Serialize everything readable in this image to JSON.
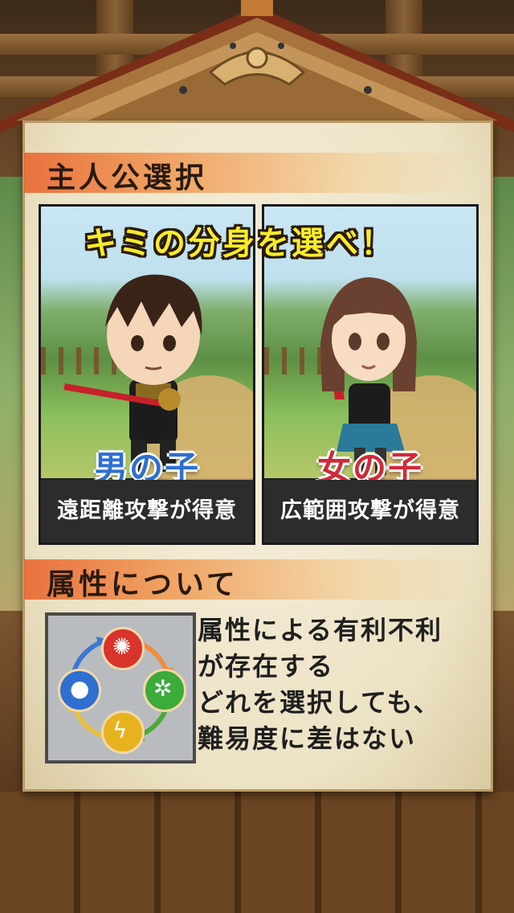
{
  "screen": {
    "section1_title": "主人公選択",
    "headline": "キミの分身を選べ！",
    "characters": [
      {
        "name": "男の子",
        "description": "遠距離攻撃が得意",
        "name_color": "#2e6fd0"
      },
      {
        "name": "女の子",
        "description": "広範囲攻撃が得意",
        "name_color": "#d02a3a"
      }
    ],
    "section2_title": "属性について",
    "attribute_lines": [
      "属性による有利不利",
      "が存在する",
      "どれを選択しても、",
      "難易度に差はない"
    ],
    "elements": [
      {
        "icon": "fire-icon",
        "color": "#d9342b"
      },
      {
        "icon": "wind-icon",
        "color": "#3bab3a"
      },
      {
        "icon": "lightning-icon",
        "color": "#e6b21e"
      },
      {
        "icon": "water-icon",
        "color": "#2f6fd1"
      }
    ]
  }
}
